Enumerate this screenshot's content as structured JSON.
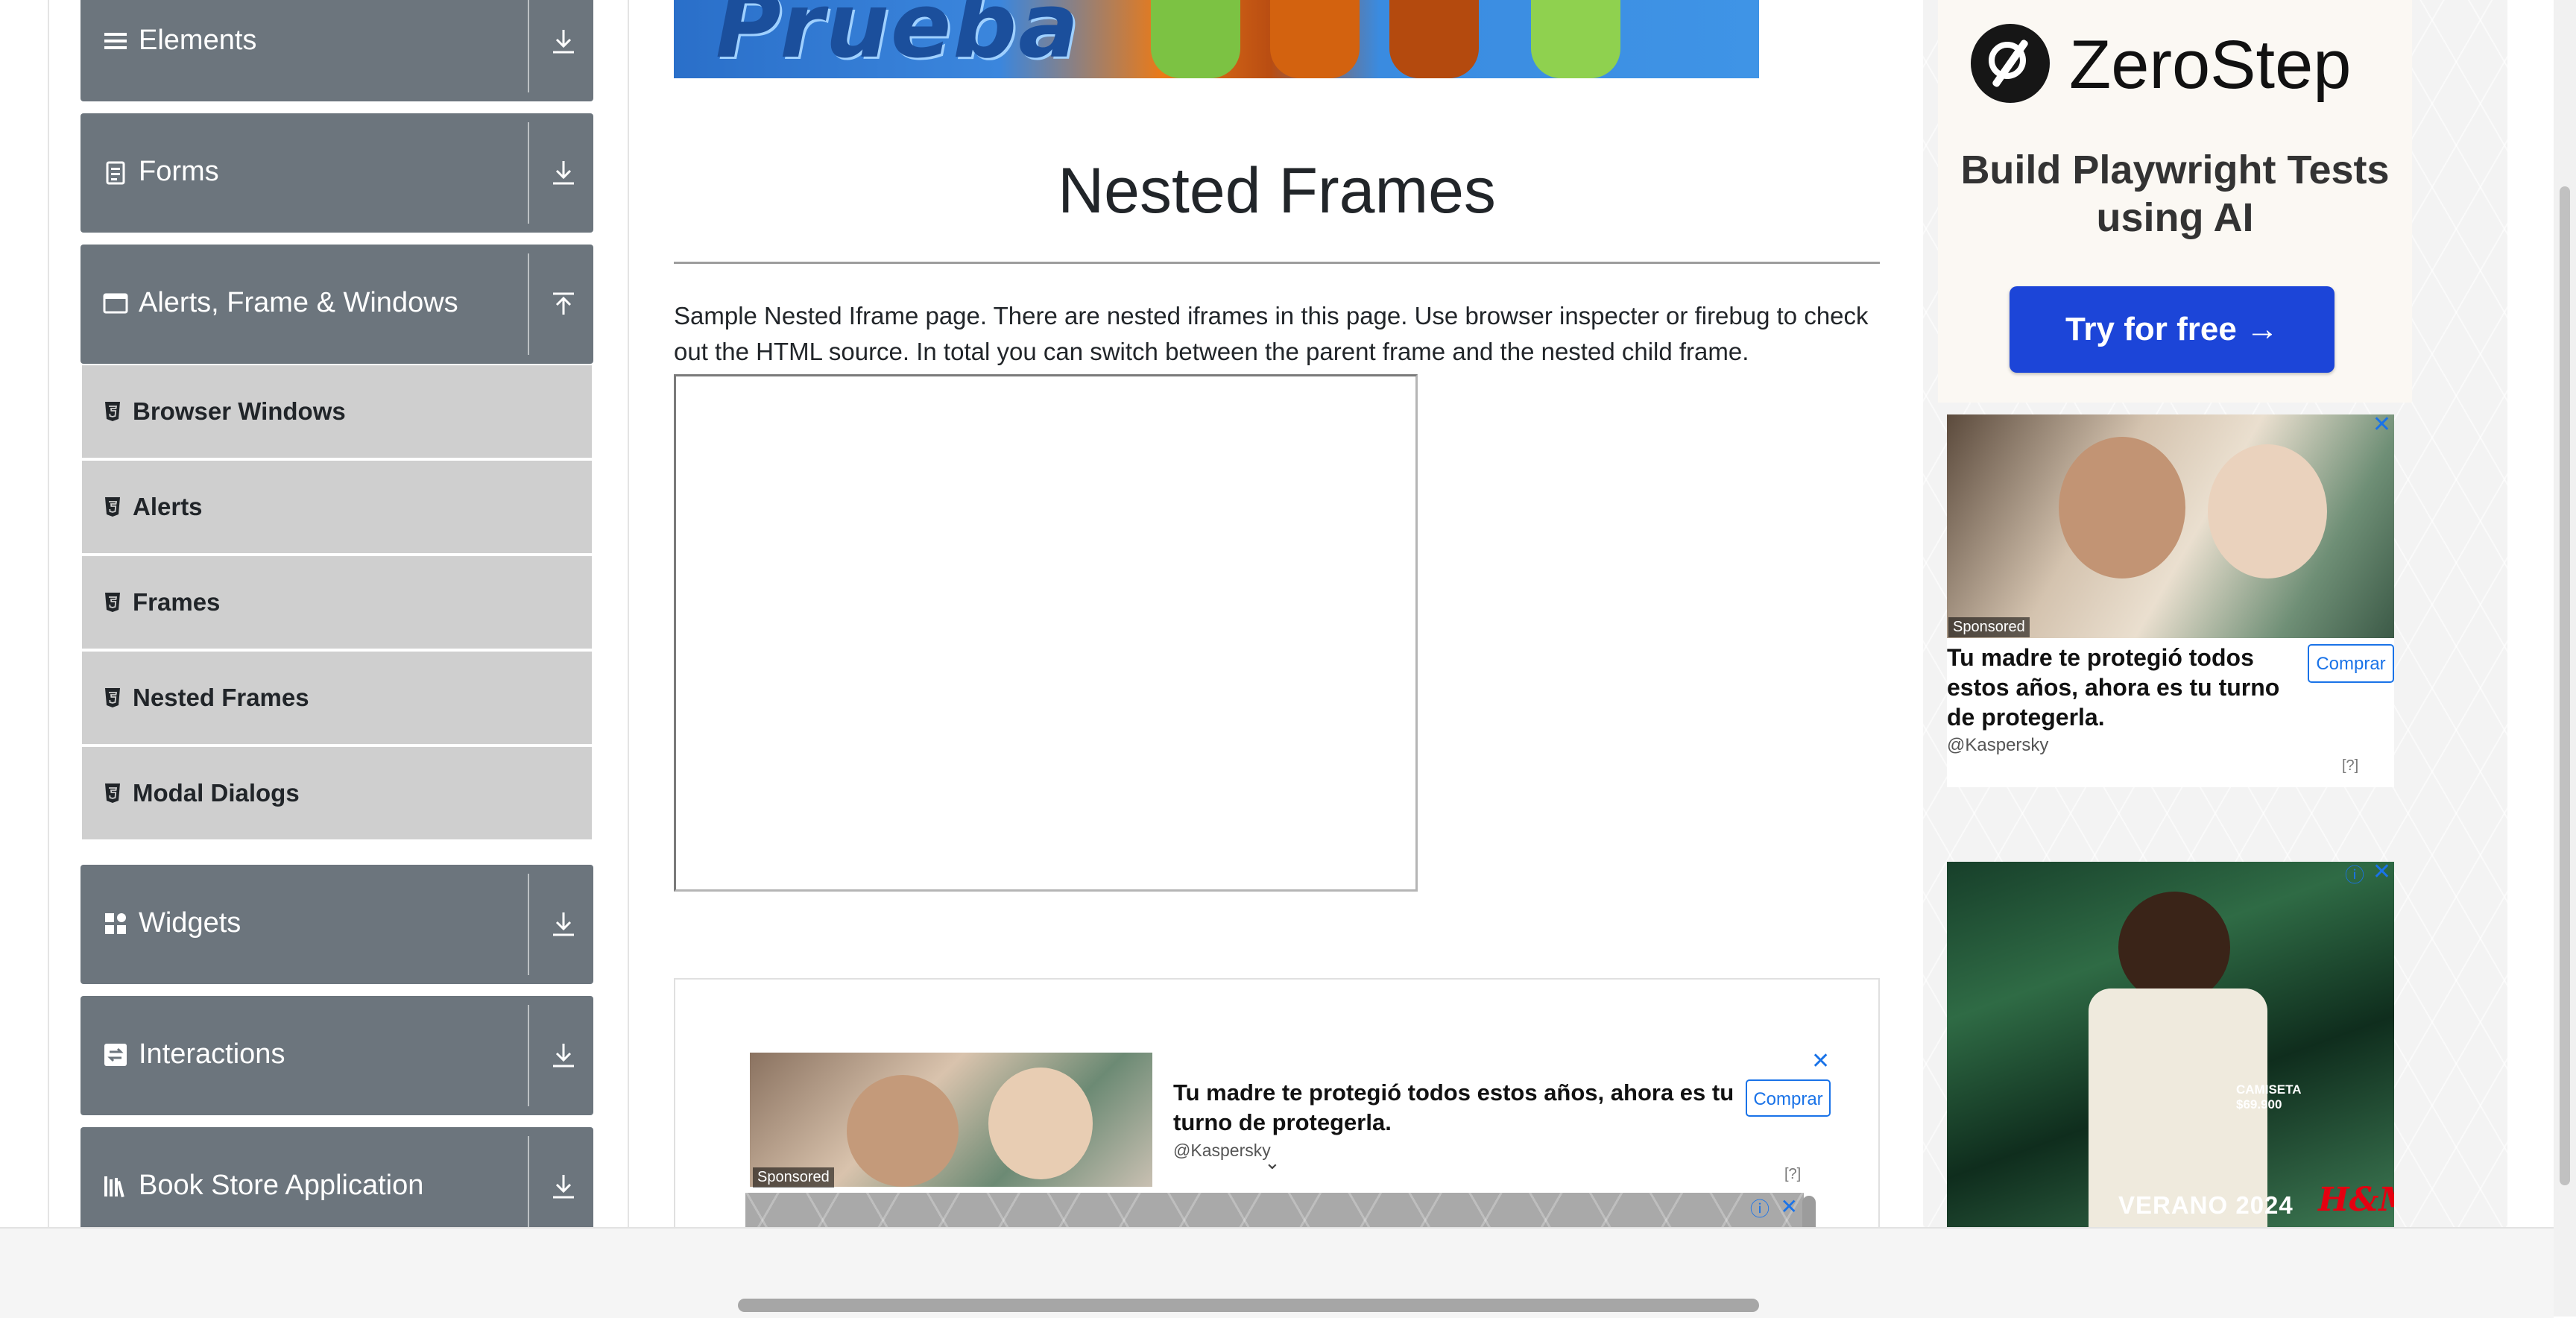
{
  "sidebar": {
    "groups": [
      {
        "label": "Elements",
        "icon": "list-icon",
        "toggle": "expand"
      },
      {
        "label": "Forms",
        "icon": "form-icon",
        "toggle": "expand"
      },
      {
        "label": "Alerts, Frame & Windows",
        "icon": "window-icon",
        "toggle": "collapse"
      },
      {
        "label": "Widgets",
        "icon": "widgets-icon",
        "toggle": "expand"
      },
      {
        "label": "Interactions",
        "icon": "interactions-icon",
        "toggle": "expand"
      },
      {
        "label": "Book Store Application",
        "icon": "book-icon",
        "toggle": "expand"
      }
    ],
    "sub_items": [
      {
        "label": "Browser Windows"
      },
      {
        "label": "Alerts"
      },
      {
        "label": "Frames"
      },
      {
        "label": "Nested Frames"
      },
      {
        "label": "Modal Dialogs"
      }
    ]
  },
  "banner": {
    "text": "Prueba"
  },
  "main": {
    "title": "Nested Frames",
    "description": "Sample Nested Iframe page. There are nested iframes in this page. Use browser inspecter or firebug to check out the HTML source. In total you can switch between the parent frame and the nested child frame."
  },
  "inline_ad": {
    "sponsored": "Sponsored",
    "headline": "Tu madre te protegió todos estos años, ahora es tu turno de protegerla.",
    "brand": "@Kaspersky",
    "cta": "Comprar",
    "close": "✕",
    "help": "[?]"
  },
  "right_ads": {
    "zerostep": {
      "name": "ZeroStep",
      "tagline": "Build Playwright Tests using AI",
      "cta": "Try for free →"
    },
    "kaspersky": {
      "sponsored": "Sponsored",
      "headline": "Tu madre te protegió todos estos años, ahora es tu turno de protegerla.",
      "brand": "@Kaspersky",
      "cta": "Comprar",
      "close": "✕",
      "help": "[?]"
    },
    "hm": {
      "camiseta": "CAMISETA",
      "price": "$69.900",
      "verano": "VERANO 2024",
      "logo": "H&M",
      "close": "✕",
      "info": "ⓘ"
    }
  },
  "overlay_ad": {
    "close": "✕",
    "info": "ⓘ"
  },
  "colors": {
    "sidebar_header": "#6c757d",
    "sub_item": "#cfcfcf",
    "cta_blue": "#1c45d8",
    "link_blue": "#1a73e8"
  }
}
